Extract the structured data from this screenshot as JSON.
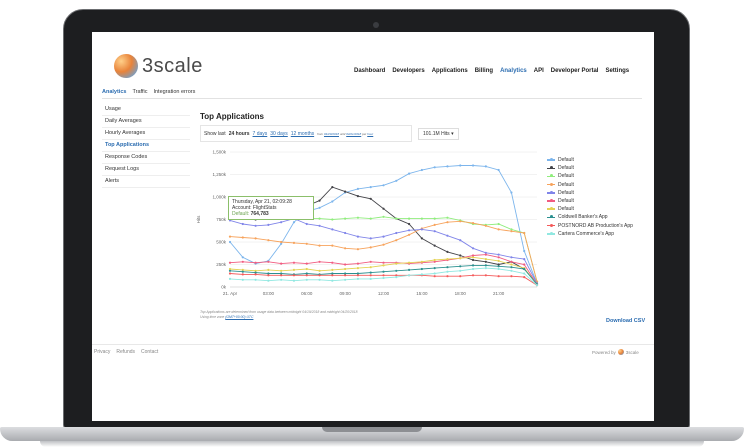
{
  "header": {
    "logo_text": "3scale",
    "nav": [
      "Dashboard",
      "Developers",
      "Applications",
      "Billing",
      "Analytics",
      "API",
      "Developer Portal",
      "Settings"
    ],
    "active_nav": "Analytics"
  },
  "subnav": {
    "items": [
      "Analytics",
      "Traffic",
      "Integration errors"
    ],
    "active": "Analytics"
  },
  "sidebar": {
    "items": [
      "Usage",
      "Daily Averages",
      "Hourly Averages",
      "Top Applications",
      "Response Codes",
      "Request Logs",
      "Alerts"
    ],
    "active": "Top Applications"
  },
  "main": {
    "title": "Top Applications",
    "filter_prefix": "Show last",
    "filter_current": "24 hours",
    "filter_options": [
      "7 days",
      "30 days",
      "12 months"
    ],
    "range_from_label": "from",
    "range_from": "04/20/2018",
    "range_until_label": "until",
    "range_until": "04/21/2018",
    "range_per_label": "per",
    "range_per": "hour",
    "hits_select": "101.1M Hits"
  },
  "tooltip": {
    "date": "Thursday, Apr 21, 02:09:28",
    "account": "Account: FlightStats",
    "series": "Default",
    "value": "764,783"
  },
  "chart_data": {
    "type": "line",
    "ylabel": "Hits",
    "ylim": [
      0,
      1500
    ],
    "yticks": [
      "0k",
      "250k",
      "500k",
      "750k",
      "1,000k",
      "1,250k",
      "1,500k"
    ],
    "xticks": [
      "21. Apr",
      "03:00",
      "06:00",
      "09:00",
      "12:00",
      "15:00",
      "18:00",
      "21:00"
    ],
    "x": [
      0,
      1,
      2,
      3,
      4,
      5,
      6,
      7,
      8,
      9,
      10,
      11,
      12,
      13,
      14,
      15,
      16,
      17,
      18,
      19,
      20,
      21,
      22,
      23,
      24
    ],
    "series": [
      {
        "name": "Default",
        "color": "#7cb5ec",
        "values": [
          500,
          330,
          260,
          290,
          480,
          720,
          840,
          880,
          950,
          1050,
          1090,
          1110,
          1130,
          1180,
          1260,
          1300,
          1330,
          1340,
          1350,
          1350,
          1340,
          1300,
          1050,
          400,
          40
        ]
      },
      {
        "name": "Default",
        "color": "#434348",
        "values": [
          780,
          820,
          750,
          870,
          900,
          870,
          900,
          960,
          1110,
          1060,
          1010,
          980,
          870,
          760,
          700,
          540,
          460,
          390,
          350,
          300,
          280,
          250,
          280,
          200,
          40
        ]
      },
      {
        "name": "Default",
        "color": "#90ed7d",
        "values": [
          780,
          770,
          760,
          780,
          770,
          770,
          760,
          760,
          750,
          760,
          770,
          760,
          780,
          760,
          760,
          760,
          760,
          770,
          740,
          700,
          690,
          700,
          640,
          600,
          60
        ]
      },
      {
        "name": "Default",
        "color": "#f7a35c",
        "values": [
          560,
          550,
          540,
          520,
          500,
          490,
          480,
          460,
          460,
          430,
          420,
          440,
          470,
          520,
          580,
          650,
          690,
          720,
          730,
          710,
          680,
          640,
          620,
          600,
          60
        ]
      },
      {
        "name": "Default",
        "color": "#8085e9",
        "values": [
          740,
          700,
          680,
          690,
          720,
          760,
          700,
          680,
          640,
          600,
          560,
          540,
          560,
          600,
          630,
          640,
          620,
          570,
          520,
          430,
          380,
          360,
          330,
          310,
          40
        ]
      },
      {
        "name": "Default",
        "color": "#f15c80",
        "values": [
          270,
          280,
          270,
          280,
          260,
          270,
          260,
          280,
          270,
          250,
          260,
          280,
          270,
          270,
          260,
          270,
          280,
          300,
          320,
          350,
          360,
          330,
          280,
          250,
          30
        ]
      },
      {
        "name": "Default",
        "color": "#e4d354",
        "values": [
          200,
          190,
          180,
          190,
          180,
          190,
          200,
          180,
          190,
          200,
          210,
          220,
          240,
          260,
          270,
          280,
          300,
          310,
          320,
          330,
          310,
          290,
          250,
          210,
          30
        ]
      },
      {
        "name": "Coldwell Banker's App",
        "color": "#2b908f",
        "values": [
          180,
          170,
          160,
          150,
          150,
          140,
          150,
          140,
          150,
          150,
          150,
          160,
          170,
          180,
          190,
          200,
          210,
          220,
          230,
          240,
          240,
          230,
          220,
          200,
          30
        ]
      },
      {
        "name": "POSTNORD AB Production's App",
        "color": "#f45b5b",
        "values": [
          150,
          140,
          140,
          130,
          130,
          130,
          130,
          130,
          130,
          130,
          130,
          130,
          130,
          130,
          130,
          130,
          120,
          120,
          120,
          130,
          130,
          120,
          120,
          110,
          20
        ]
      },
      {
        "name": "Cartera Commerce's App",
        "color": "#91e8e1",
        "values": [
          90,
          80,
          80,
          70,
          80,
          70,
          80,
          80,
          70,
          80,
          90,
          90,
          100,
          110,
          130,
          140,
          150,
          170,
          180,
          200,
          210,
          200,
          180,
          150,
          20
        ]
      }
    ],
    "legend_position": "right",
    "grid": true
  },
  "footnote": {
    "line1": "Top Applications are determined from usage data between midnight 04/19/2018 and midnight 04/20/2018",
    "line2_prefix": "Using time zone",
    "line2_tz": "(GMT+00:00) UTC"
  },
  "download_label": "Download CSV",
  "footer": {
    "links": [
      "Privacy",
      "Refunds",
      "Contact"
    ],
    "powered_by": "Powered by",
    "powered_brand": "3scale"
  }
}
